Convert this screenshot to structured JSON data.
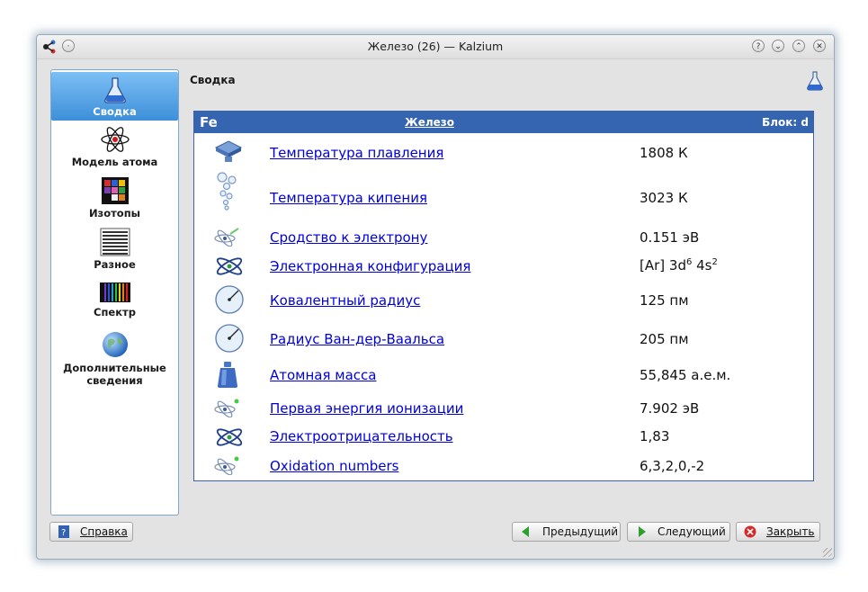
{
  "window": {
    "title": "Железо (26) — Kalzium",
    "title_buttons": [
      "?",
      "⌄",
      "⌃",
      "✕"
    ]
  },
  "sidebar": {
    "items": [
      {
        "label": "Сводка",
        "icon": "flask-icon",
        "active": true
      },
      {
        "label": "Модель атома",
        "icon": "atom-icon"
      },
      {
        "label": "Изотопы",
        "icon": "isotopes-icon"
      },
      {
        "label": "Разное",
        "icon": "misc-icon"
      },
      {
        "label": "Спектр",
        "icon": "spectrum-icon"
      },
      {
        "label": "Дополнительные сведения",
        "icon": "globe-icon"
      }
    ]
  },
  "main": {
    "title": "Сводка",
    "element": {
      "symbol": "Fe",
      "name": "Железо",
      "block": "Блок: d"
    },
    "rows": [
      {
        "label": "Температура плавления",
        "value": "1808 К",
        "icon": "melting-icon"
      },
      {
        "label": "Температура кипения",
        "value": "3023 К",
        "icon": "boiling-icon"
      },
      {
        "label": "Сродство к электрону",
        "value": "0.151 эВ",
        "icon": "electron-affinity-icon"
      },
      {
        "label": "Электронная конфигурация",
        "value_parts": [
          "[Ar] 3d",
          "6",
          " 4s",
          "2"
        ],
        "icon": "electron-config-icon"
      },
      {
        "label": "Ковалентный радиус",
        "value": "125 пм",
        "icon": "radius-icon"
      },
      {
        "label": "Радиус Ван-дер-Ваальса",
        "value": "205 пм",
        "icon": "vdw-radius-icon"
      },
      {
        "label": "Атомная масса",
        "value": "55,845 а.е.м.",
        "icon": "weight-icon"
      },
      {
        "label": "Первая энергия ионизации",
        "value": "7.902 эВ",
        "icon": "ionization-icon"
      },
      {
        "label": "Электроотрицательность",
        "value": "1,83",
        "icon": "electronegativity-icon"
      },
      {
        "label": "Oxidation numbers",
        "value": "6,3,2,0,-2",
        "icon": "oxidation-icon"
      }
    ]
  },
  "buttons": {
    "help": "Справка",
    "prev": "Предыдущий",
    "next": "Следующий",
    "close": "Закрыть"
  },
  "colors": {
    "header_blue": "#3565b0",
    "link": "#0000dd",
    "sidebar_active": "#3d8fd9"
  }
}
